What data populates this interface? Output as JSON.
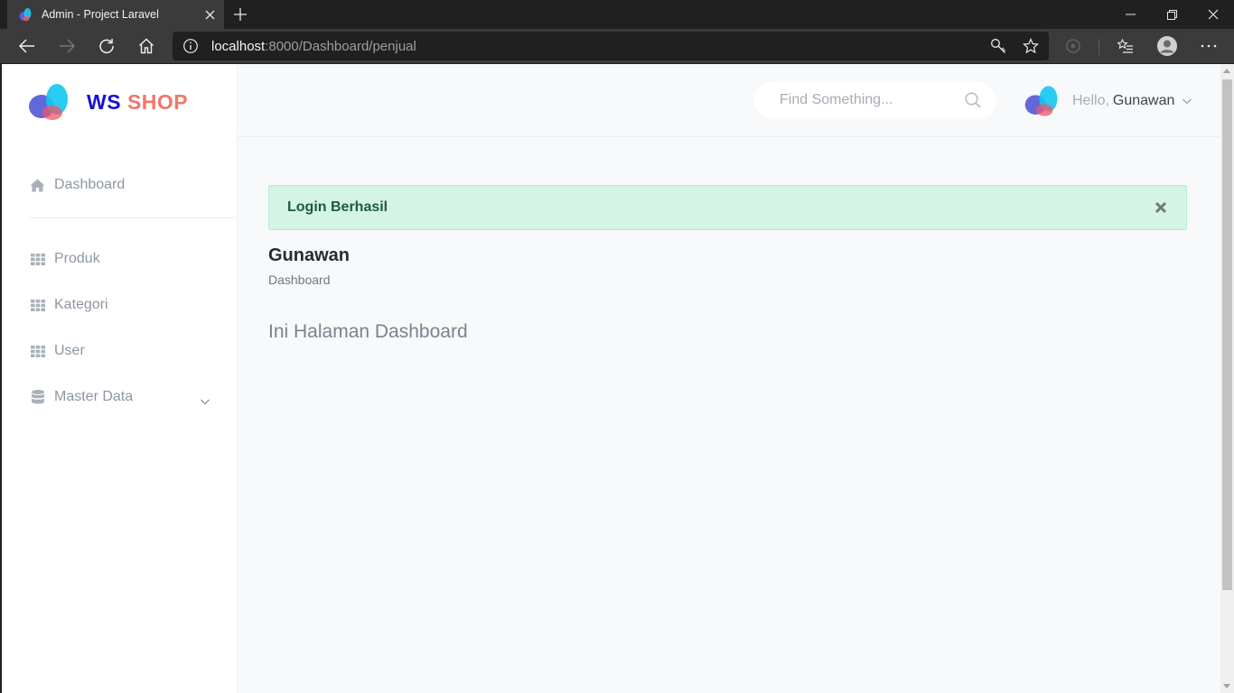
{
  "browser": {
    "tab_title": "Admin - Project Laravel",
    "url_host": "localhost",
    "url_path": ":8000/Dashboard/penjual"
  },
  "brand": {
    "ws": "WS",
    "shop": "SHOP",
    "colors": {
      "ws": "#1610d9",
      "shop": "#f0776a"
    }
  },
  "sidebar": {
    "items": [
      {
        "label": "Dashboard",
        "icon": "home-icon"
      },
      {
        "label": "Produk",
        "icon": "grid-icon"
      },
      {
        "label": "Kategori",
        "icon": "grid-icon"
      },
      {
        "label": "User",
        "icon": "grid-icon"
      },
      {
        "label": "Master Data",
        "icon": "database-icon"
      }
    ]
  },
  "header": {
    "search_placeholder": "Find Something...",
    "hello": "Hello,",
    "username": "Gunawan"
  },
  "alert": {
    "message": "Login Berhasil",
    "colors": {
      "background": "#d4f4e6",
      "text": "#1c5b3e"
    }
  },
  "main": {
    "title": "Gunawan",
    "breadcrumb": "Dashboard",
    "content": "Ini Halaman Dashboard"
  }
}
